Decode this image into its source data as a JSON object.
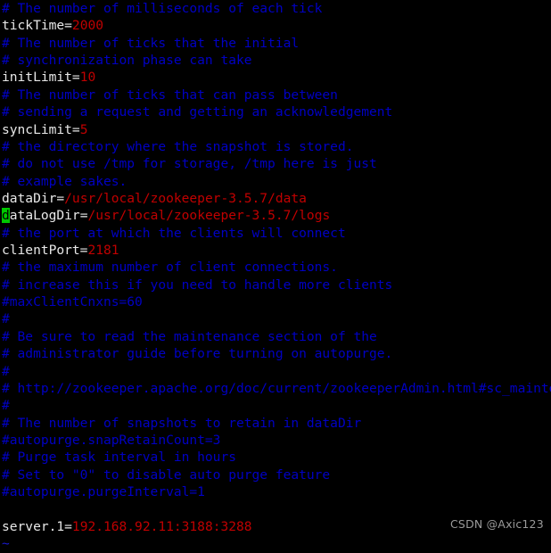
{
  "editor": {
    "app": "vim",
    "file_type": "zookeeper-config",
    "background_color": "#000000",
    "colors": {
      "comment": "#0000c4",
      "key": "#e8e8e8",
      "value": "#c00000",
      "cursor_bg": "#00c800",
      "cursor_fg": "#000000",
      "tilde": "#1a1ad0",
      "watermark": "#9a9a9a"
    },
    "cursor": {
      "line_index": 13,
      "column": 0,
      "character": "d"
    },
    "lines": [
      {
        "type": "comment",
        "text": "# The number of milliseconds of each tick"
      },
      {
        "type": "setting",
        "key": "tickTime",
        "eq": "=",
        "value": "2000"
      },
      {
        "type": "comment",
        "text": "# The number of ticks that the initial"
      },
      {
        "type": "comment",
        "text": "# synchronization phase can take"
      },
      {
        "type": "setting",
        "key": "initLimit",
        "eq": "=",
        "value": "10"
      },
      {
        "type": "comment",
        "text": "# The number of ticks that can pass between"
      },
      {
        "type": "comment",
        "text": "# sending a request and getting an acknowledgement"
      },
      {
        "type": "setting",
        "key": "syncLimit",
        "eq": "=",
        "value": "5"
      },
      {
        "type": "comment",
        "text": "# the directory where the snapshot is stored."
      },
      {
        "type": "comment",
        "text": "# do not use /tmp for storage, /tmp here is just"
      },
      {
        "type": "comment",
        "text": "# example sakes."
      },
      {
        "type": "setting",
        "key": "dataDir",
        "eq": "=",
        "value": "/usr/local/zookeeper-3.5.7/data"
      },
      {
        "type": "setting_cursor",
        "key": "dataLogDir",
        "eq": "=",
        "value": "/usr/local/zookeeper-3.5.7/logs"
      },
      {
        "type": "comment",
        "text": "# the port at which the clients will connect"
      },
      {
        "type": "setting",
        "key": "clientPort",
        "eq": "=",
        "value": "2181"
      },
      {
        "type": "comment",
        "text": "# the maximum number of client connections."
      },
      {
        "type": "comment",
        "text": "# increase this if you need to handle more clients"
      },
      {
        "type": "comment",
        "text": "#maxClientCnxns=60"
      },
      {
        "type": "comment",
        "text": "#"
      },
      {
        "type": "comment",
        "text": "# Be sure to read the maintenance section of the"
      },
      {
        "type": "comment",
        "text": "# administrator guide before turning on autopurge."
      },
      {
        "type": "comment",
        "text": "#"
      },
      {
        "type": "comment",
        "text": "# http://zookeeper.apache.org/doc/current/zookeeperAdmin.html#sc_maintenance"
      },
      {
        "type": "comment",
        "text": "#"
      },
      {
        "type": "comment",
        "text": "# The number of snapshots to retain in dataDir"
      },
      {
        "type": "comment",
        "text": "#autopurge.snapRetainCount=3"
      },
      {
        "type": "comment",
        "text": "# Purge task interval in hours"
      },
      {
        "type": "comment",
        "text": "# Set to \"0\" to disable auto purge feature"
      },
      {
        "type": "comment",
        "text": "#autopurge.purgeInterval=1"
      },
      {
        "type": "blank",
        "text": ""
      },
      {
        "type": "setting",
        "key": "server.1",
        "eq": "=",
        "value": "192.168.92.11:3188:3288"
      },
      {
        "type": "tilde",
        "text": "~"
      }
    ]
  },
  "watermark": {
    "text": "CSDN @Axic123"
  }
}
